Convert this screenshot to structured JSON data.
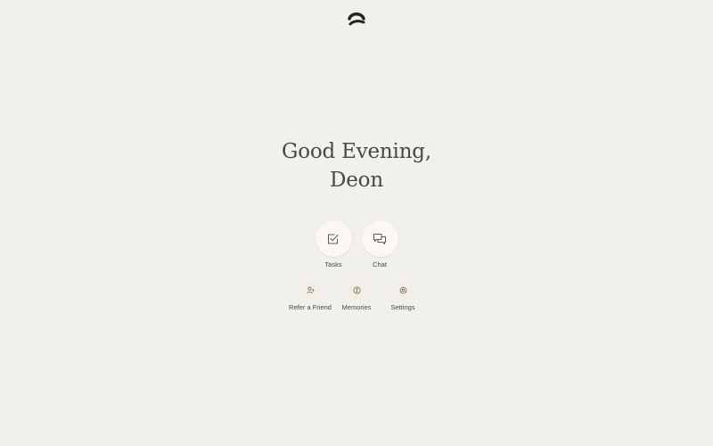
{
  "greeting": {
    "line1": "Good Evening,",
    "line2": "Deon"
  },
  "main_actions": [
    {
      "label": "Tasks",
      "icon": "checkbox-icon"
    },
    {
      "label": "Chat",
      "icon": "chat-bubbles-icon"
    }
  ],
  "sub_actions": [
    {
      "label": "Refer a Friend",
      "icon": "add-user-icon"
    },
    {
      "label": "Memories",
      "icon": "memory-icon"
    },
    {
      "label": "Settings",
      "icon": "gear-icon"
    }
  ],
  "colors": {
    "background": "#f1f0ec",
    "text": "#4a4744",
    "icon": "#5c5955",
    "main_circle": "#fbf8f4",
    "sub_circle": "#f4ede4"
  }
}
